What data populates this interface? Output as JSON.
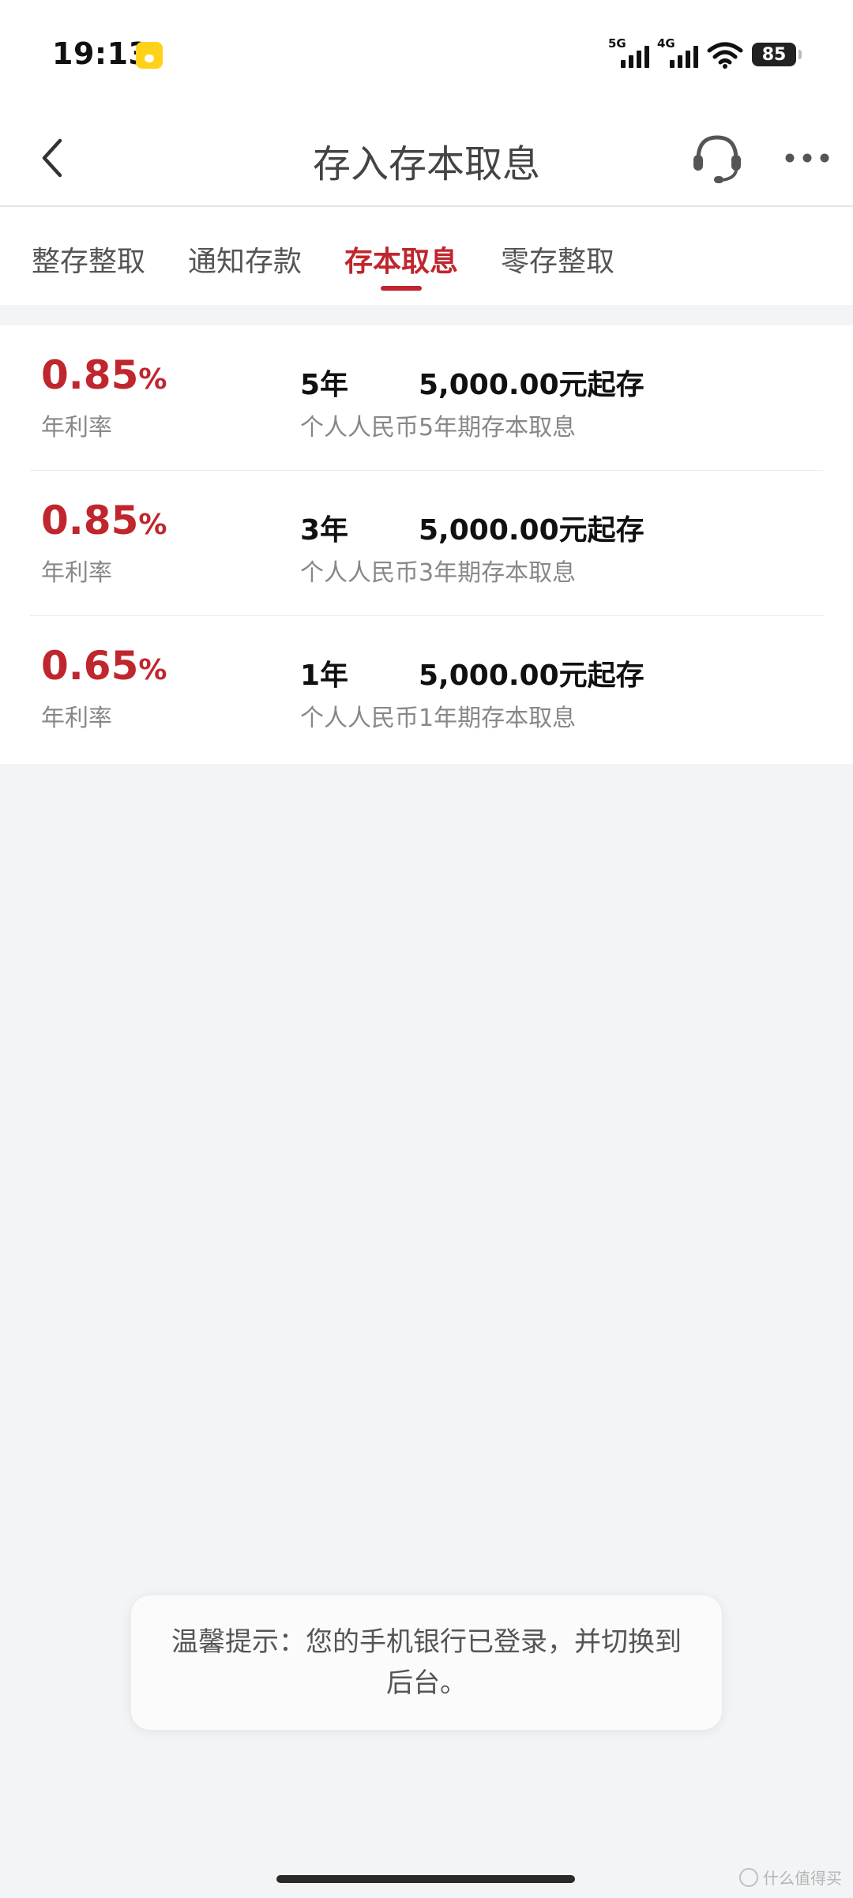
{
  "status_bar": {
    "time": "19:13",
    "network_1": "5G",
    "network_2": "4G",
    "battery": "85"
  },
  "header": {
    "title": "存入存本取息",
    "back_icon": "chevron-left-icon",
    "support_icon": "headset-icon",
    "more_icon": "more-dots-icon"
  },
  "tabs": [
    {
      "label": "整存整取"
    },
    {
      "label": "通知存款"
    },
    {
      "label": "存本取息"
    },
    {
      "label": "零存整取"
    }
  ],
  "active_tab": "存本取息",
  "products": [
    {
      "rate": "0.85",
      "rate_unit": "%",
      "rate_label": "年利率",
      "term": "5年",
      "min_amount": "5,000.00元起存",
      "name": "个人人民币5年期存本取息"
    },
    {
      "rate": "0.85",
      "rate_unit": "%",
      "rate_label": "年利率",
      "term": "3年",
      "min_amount": "5,000.00元起存",
      "name": "个人人民币3年期存本取息"
    },
    {
      "rate": "0.65",
      "rate_unit": "%",
      "rate_label": "年利率",
      "term": "1年",
      "min_amount": "5,000.00元起存",
      "name": "个人人民币1年期存本取息"
    }
  ],
  "toast": {
    "text": "温馨提示：您的手机银行已登录，并切换到后台。"
  },
  "watermark": {
    "text": "什么值得买"
  },
  "colors": {
    "accent": "#c0262d",
    "background": "#f3f4f6",
    "card": "#ffffff"
  }
}
